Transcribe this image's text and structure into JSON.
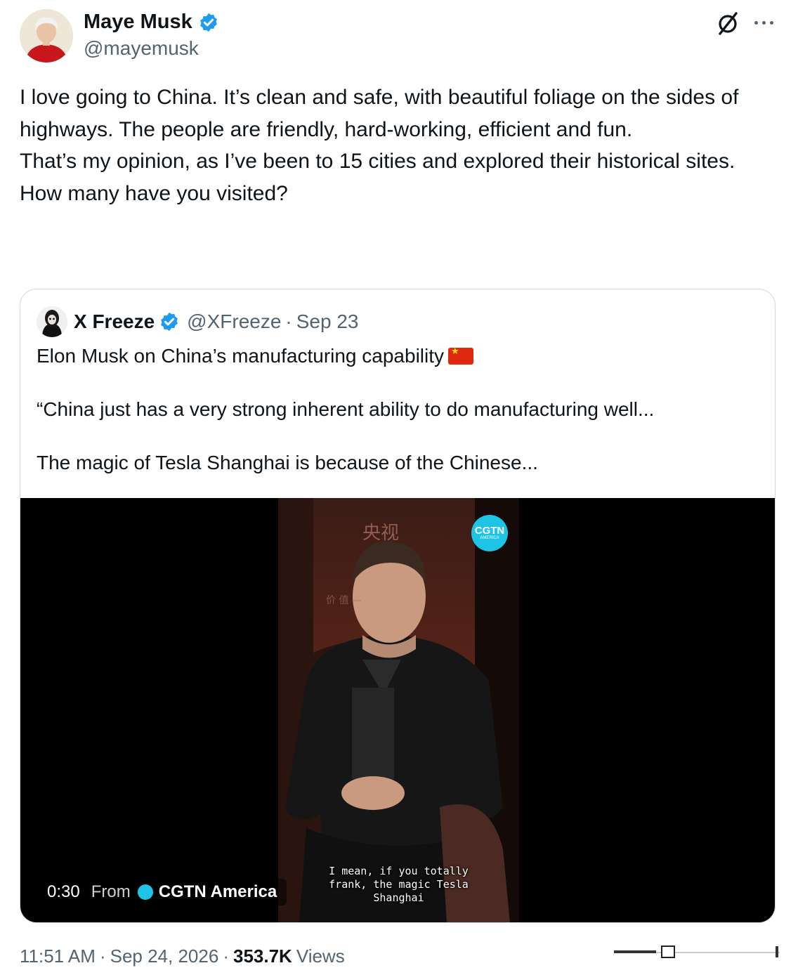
{
  "author": {
    "display_name": "Maye Musk",
    "handle": "@mayemusk",
    "verified": true
  },
  "header_actions": {
    "grok_icon": "grok-icon",
    "more_icon": "more-icon"
  },
  "tweet": {
    "paragraphs": [
      "I love going to China. It’s clean and safe, with beautiful foliage on the sides of highways. The people are friendly, hard-working, efficient and fun.",
      "That’s my opinion, as I’ve been to 15 cities and explored their historical sites.",
      "How many have you visited?"
    ]
  },
  "quoted_tweet": {
    "display_name": "X Freeze",
    "handle": "@XFreeze",
    "separator": "·",
    "date": "Sep 23",
    "verified": true,
    "text_line1": "Elon Musk on China’s manufacturing capability",
    "text_line2": "“China just has a very strong inherent ability to do manufacturing well...",
    "text_line3": "The magic of Tesla Shanghai is because of the Chinese..."
  },
  "video": {
    "duration": "0:30",
    "from_label": "From",
    "source_name": "CGTN America",
    "logo_text": "CGTN",
    "logo_subtext": "AMERICA",
    "subtitle": "I mean, if you totally\nfrank, the magic Tesla\nShanghai"
  },
  "footer": {
    "time": "11:51 AM",
    "separator": "·",
    "date": "Sep 24, 2026",
    "views_count": "353.7K",
    "views_label": "Views"
  },
  "colors": {
    "text_primary": "#0f1419",
    "text_secondary": "#536471",
    "verified_blue": "#1d9bf0",
    "border": "#cfd9de",
    "cgtn_cyan": "#1ec4e6"
  }
}
